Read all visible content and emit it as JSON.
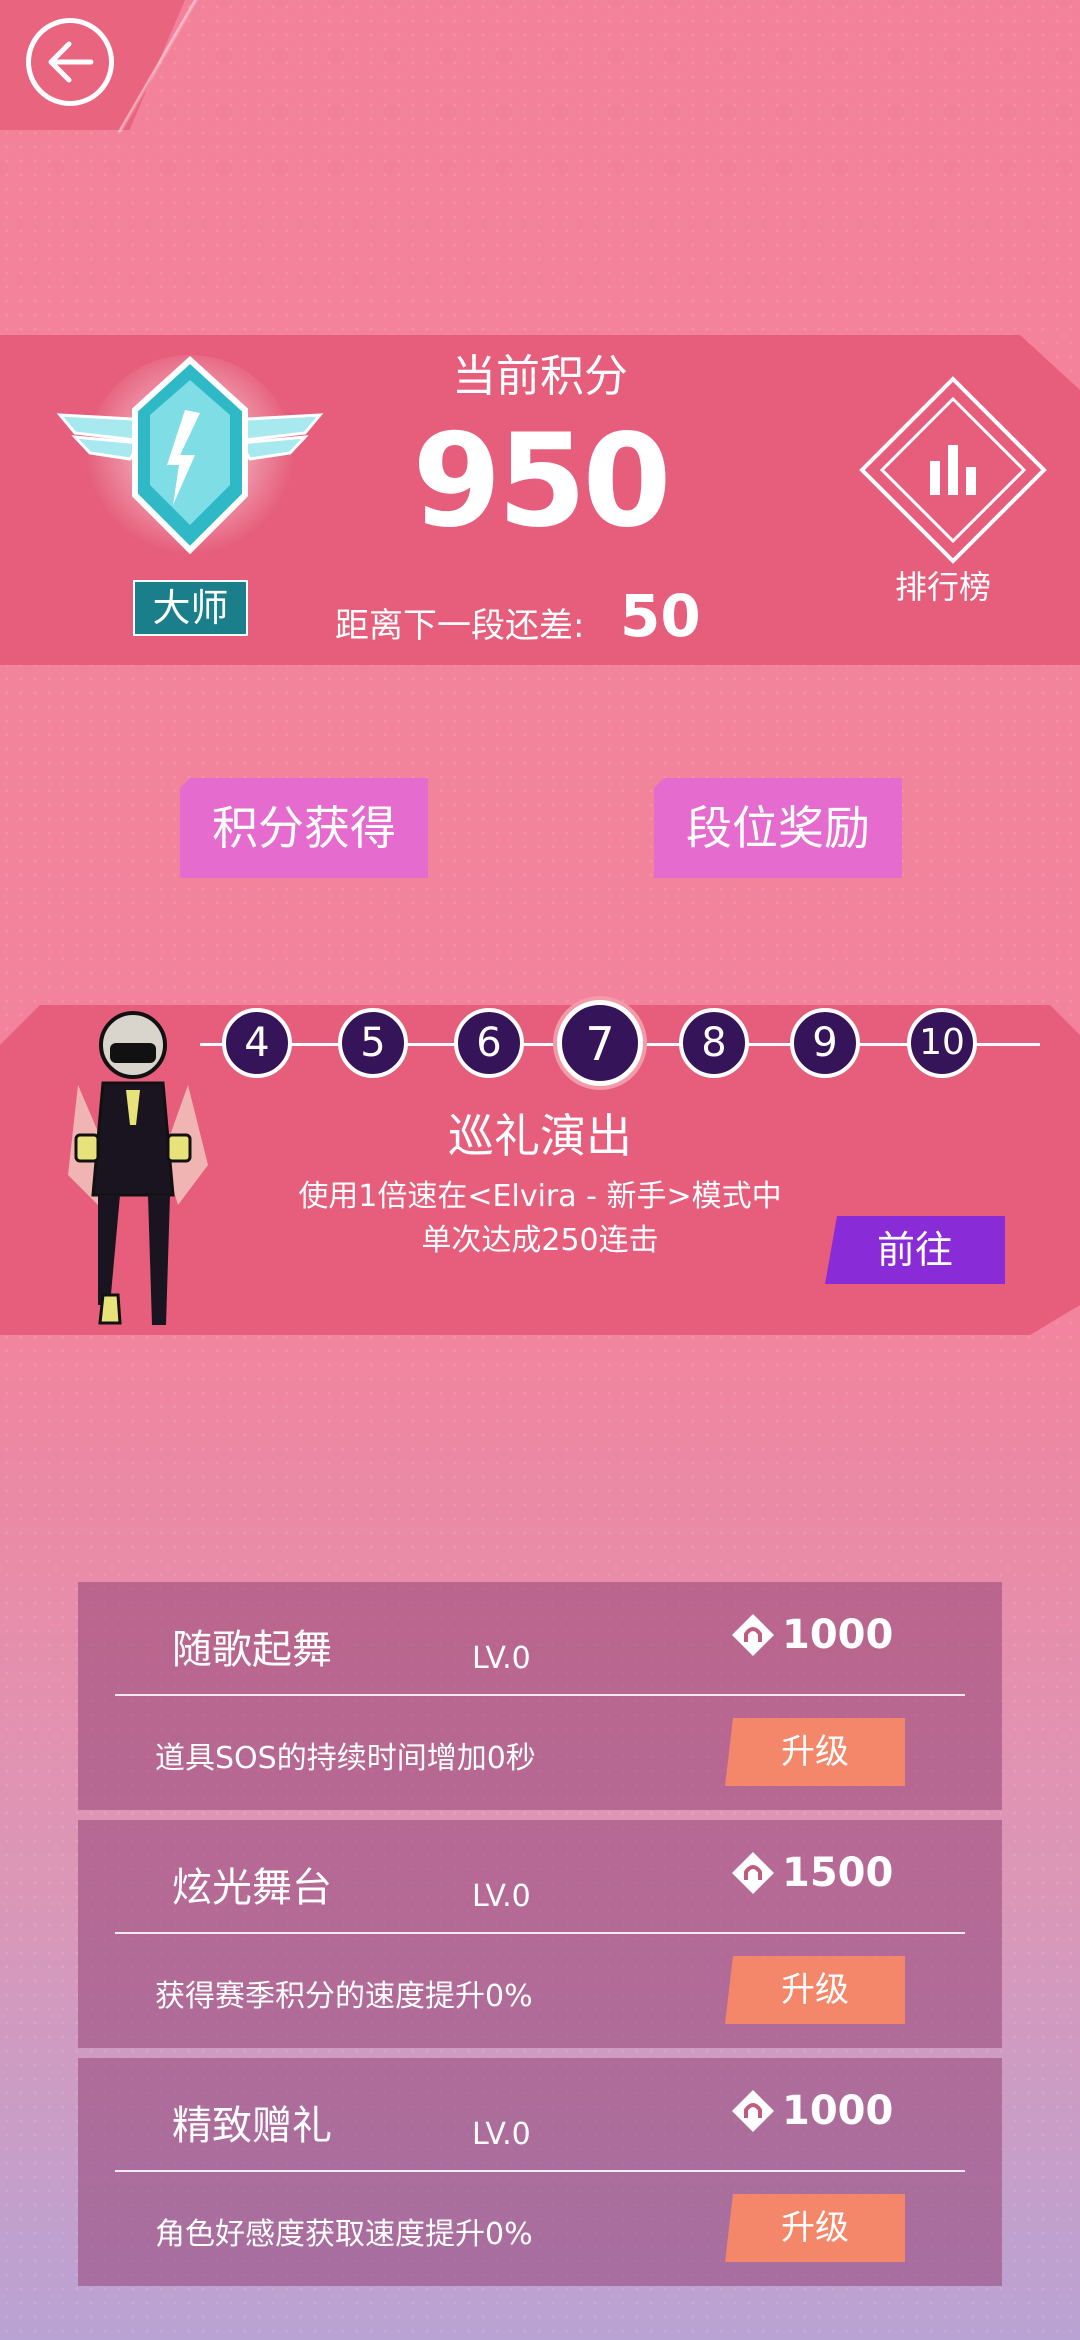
{
  "score": {
    "title": "当前积分",
    "value": "950",
    "next_label": "距离下一段还差:",
    "next_value": "50",
    "rank": "大师"
  },
  "leaderboard": {
    "label": "排行榜"
  },
  "buttons": {
    "earn": "积分获得",
    "reward": "段位奖励"
  },
  "track": {
    "steps": [
      "4",
      "5",
      "6",
      "7",
      "8",
      "9",
      "10"
    ],
    "current_index": 3,
    "title": "巡礼演出",
    "desc_line1": "使用1倍速在<Elvira - 新手>模式中",
    "desc_line2": "单次达成250连击",
    "go": "前往"
  },
  "upgrades": [
    {
      "name": "随歌起舞",
      "level": "LV.0",
      "cost": "1000",
      "desc": "道具SOS的持续时间增加0秒",
      "button": "升级"
    },
    {
      "name": "炫光舞台",
      "level": "LV.0",
      "cost": "1500",
      "desc": "获得赛季积分的速度提升0%",
      "button": "升级"
    },
    {
      "name": "精致赠礼",
      "level": "LV.0",
      "cost": "1000",
      "desc": "角色好感度获取速度提升0%",
      "button": "升级"
    }
  ],
  "colors": {
    "banner": "#e65e7b",
    "pink_button": "#e56bce",
    "go_button": "#8a2bd8",
    "upgrade_button": "#f4866a",
    "rank_tag": "#1a7f8a"
  }
}
